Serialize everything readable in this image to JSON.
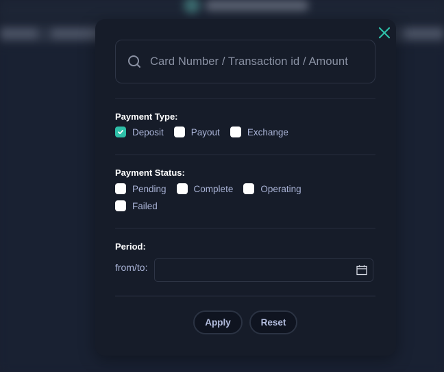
{
  "modal": {
    "close_icon": "close-icon",
    "search": {
      "placeholder": "Card Number / Transaction id / Amount",
      "value": "",
      "icon": "search-icon"
    },
    "payment_type": {
      "title": "Payment Type:",
      "options": [
        {
          "label": "Deposit",
          "checked": true
        },
        {
          "label": "Payout",
          "checked": false
        },
        {
          "label": "Exchange",
          "checked": false
        }
      ]
    },
    "payment_status": {
      "title": "Payment Status:",
      "options": [
        {
          "label": "Pending",
          "checked": false
        },
        {
          "label": "Complete",
          "checked": false
        },
        {
          "label": "Operating",
          "checked": false
        },
        {
          "label": "Failed",
          "checked": false
        }
      ]
    },
    "period": {
      "title": "Period:",
      "range_label": "from/to:",
      "value": "",
      "icon": "calendar-icon"
    },
    "buttons": {
      "apply": "Apply",
      "reset": "Reset"
    }
  },
  "colors": {
    "accent": "#2ebfa8",
    "modal_bg": "#161c29",
    "page_bg": "#1a2131",
    "label_text": "#a9b3d6"
  }
}
